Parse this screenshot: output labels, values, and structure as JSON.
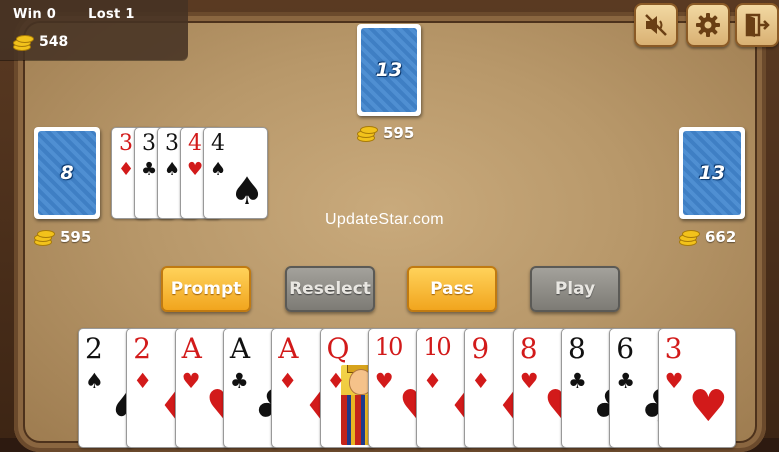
{
  "stats": {
    "win_label": "Win 0",
    "lost_label": "Lost 1",
    "coins": "548"
  },
  "controls": {
    "sound_icon": "sound-muted-icon",
    "settings_icon": "gear-icon",
    "exit_icon": "exit-door-icon"
  },
  "opponents": {
    "top": {
      "cards_left": "13",
      "coins": "595"
    },
    "left": {
      "cards_left": "8",
      "coins": "595"
    },
    "right": {
      "cards_left": "13",
      "coins": "662"
    }
  },
  "played_cards": [
    {
      "rank": "3",
      "suit": "♦",
      "color": "red"
    },
    {
      "rank": "3",
      "suit": "♣",
      "color": "black"
    },
    {
      "rank": "3",
      "suit": "♠",
      "color": "black"
    },
    {
      "rank": "4",
      "suit": "♥",
      "color": "red"
    },
    {
      "rank": "4",
      "suit": "♠",
      "color": "black"
    }
  ],
  "watermark": "UpdateStar.com",
  "buttons": {
    "prompt": "Prompt",
    "reselect": "Reselect",
    "pass": "Pass",
    "play": "Play"
  },
  "hand": [
    {
      "rank": "2",
      "suit": "♠",
      "color": "black"
    },
    {
      "rank": "2",
      "suit": "♦",
      "color": "red"
    },
    {
      "rank": "A",
      "suit": "♥",
      "color": "red"
    },
    {
      "rank": "A",
      "suit": "♣",
      "color": "black"
    },
    {
      "rank": "A",
      "suit": "♦",
      "color": "red"
    },
    {
      "rank": "Q",
      "suit": "♦",
      "color": "red",
      "face": true
    },
    {
      "rank": "10",
      "suit": "♥",
      "color": "red"
    },
    {
      "rank": "10",
      "suit": "♦",
      "color": "red"
    },
    {
      "rank": "9",
      "suit": "♦",
      "color": "red"
    },
    {
      "rank": "8",
      "suit": "♥",
      "color": "red"
    },
    {
      "rank": "8",
      "suit": "♣",
      "color": "black"
    },
    {
      "rank": "6",
      "suit": "♣",
      "color": "black"
    },
    {
      "rank": "3",
      "suit": "♥",
      "color": "red"
    }
  ],
  "colors": {
    "gold": "#f1a51e",
    "grey": "#7d7b75",
    "felt": "#b8986a",
    "card_back": "#3f7fc4"
  }
}
